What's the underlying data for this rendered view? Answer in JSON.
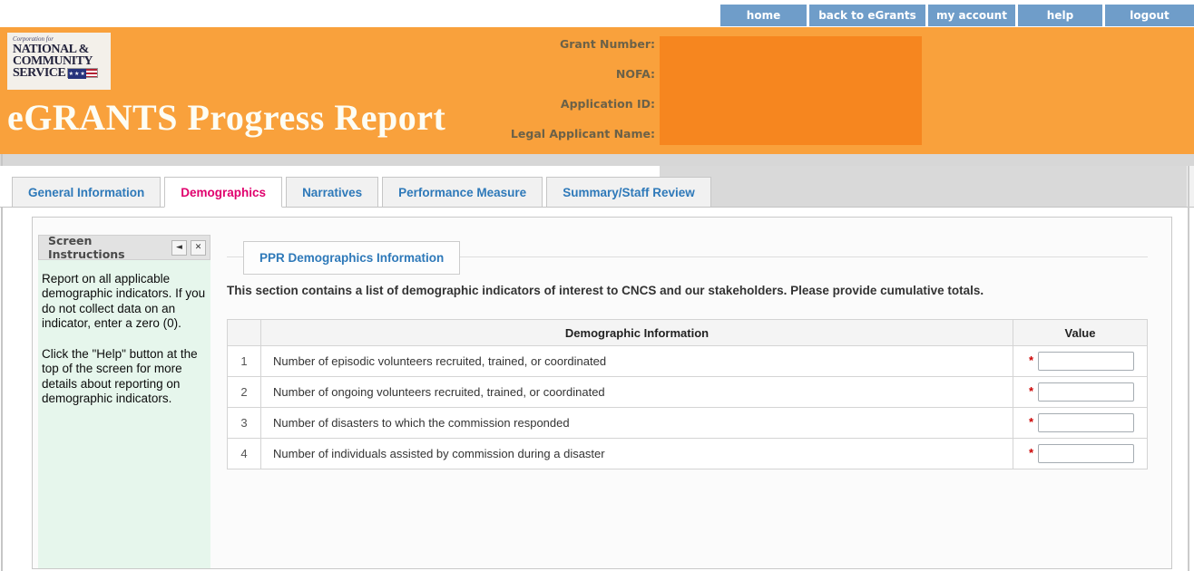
{
  "nav": {
    "items": [
      {
        "label": "home"
      },
      {
        "label": "back to eGrants"
      },
      {
        "label": "my account"
      },
      {
        "label": "help"
      },
      {
        "label": "logout"
      }
    ]
  },
  "banner": {
    "logo": {
      "corp_line": "Corporation for",
      "line1": "NATIONAL &",
      "line2": "COMMUNITY",
      "line3": "SERVICE",
      "flag_stars": "★★★"
    },
    "title": "eGRANTS Progress Report",
    "fields": [
      {
        "label": "Grant Number:"
      },
      {
        "label": "NOFA:"
      },
      {
        "label": "Application ID:"
      },
      {
        "label": "Legal Applicant Name:"
      }
    ]
  },
  "tabs": [
    {
      "label": "General Information",
      "active": false
    },
    {
      "label": "Demographics",
      "active": true
    },
    {
      "label": "Narratives",
      "active": false
    },
    {
      "label": "Performance Measure",
      "active": false
    },
    {
      "label": "Summary/Staff Review",
      "active": false
    }
  ],
  "sidebar": {
    "title": "Screen Instructions",
    "collapse_icon": "◄",
    "close_icon": "✕",
    "paragraphs": [
      "Report on all applicable demographic indicators.  If you do not collect data on an indicator, enter a zero (0).",
      "Click the \"Help\" button at the top of the screen for more details about reporting on demographic indicators."
    ]
  },
  "main": {
    "section_title": "PPR Demographics Information",
    "description": "This section contains a list of demographic indicators of interest to CNCS and our stakeholders. Please provide cumulative totals.",
    "table": {
      "number_header": "",
      "info_header": "Demographic Information",
      "value_header": "Value",
      "rows": [
        {
          "number": "1",
          "description": "Number of episodic volunteers recruited, trained, or coordinated",
          "required": "*",
          "value": ""
        },
        {
          "number": "2",
          "description": "Number of ongoing volunteers recruited, trained, or coordinated",
          "required": "*",
          "value": ""
        },
        {
          "number": "3",
          "description": "Number of disasters to which the commission responded",
          "required": "*",
          "value": ""
        },
        {
          "number": "4",
          "description": "Number of individuals assisted by commission during a disaster",
          "required": "*",
          "value": ""
        }
      ]
    }
  },
  "colors": {
    "nav_blue": "#6f9dc9",
    "banner_orange": "#f9a13c",
    "redacted_orange": "#f6861f",
    "active_tab_pink": "#e0006d",
    "link_blue": "#2e79b9",
    "instructions_green": "#e6f6ec",
    "required_red": "#cc0000"
  }
}
